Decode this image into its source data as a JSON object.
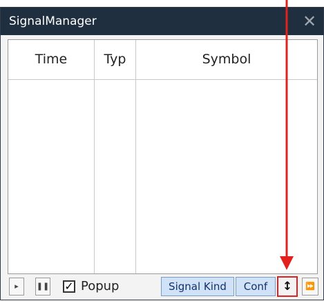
{
  "window": {
    "title": "SignalManager"
  },
  "table": {
    "columns": [
      "Time",
      "Typ",
      "Symbol"
    ]
  },
  "toolbar": {
    "popup_label": "Popup",
    "popup_checked": true,
    "signal_kind_label": "Signal Kind",
    "conf_label": "Conf"
  },
  "icons": {
    "close": "close-icon",
    "play_left": "play-icon",
    "pause": "pause-icon",
    "resize": "resize-vertical-icon",
    "fast_forward": "fast-forward-icon"
  },
  "colors": {
    "titlebar_bg": "#1f2f3f",
    "titlebar_text": "#ffffff",
    "tab_bg": "#cfe2f7",
    "tab_border": "#7a9cc0",
    "highlight_red": "#e2201d"
  }
}
